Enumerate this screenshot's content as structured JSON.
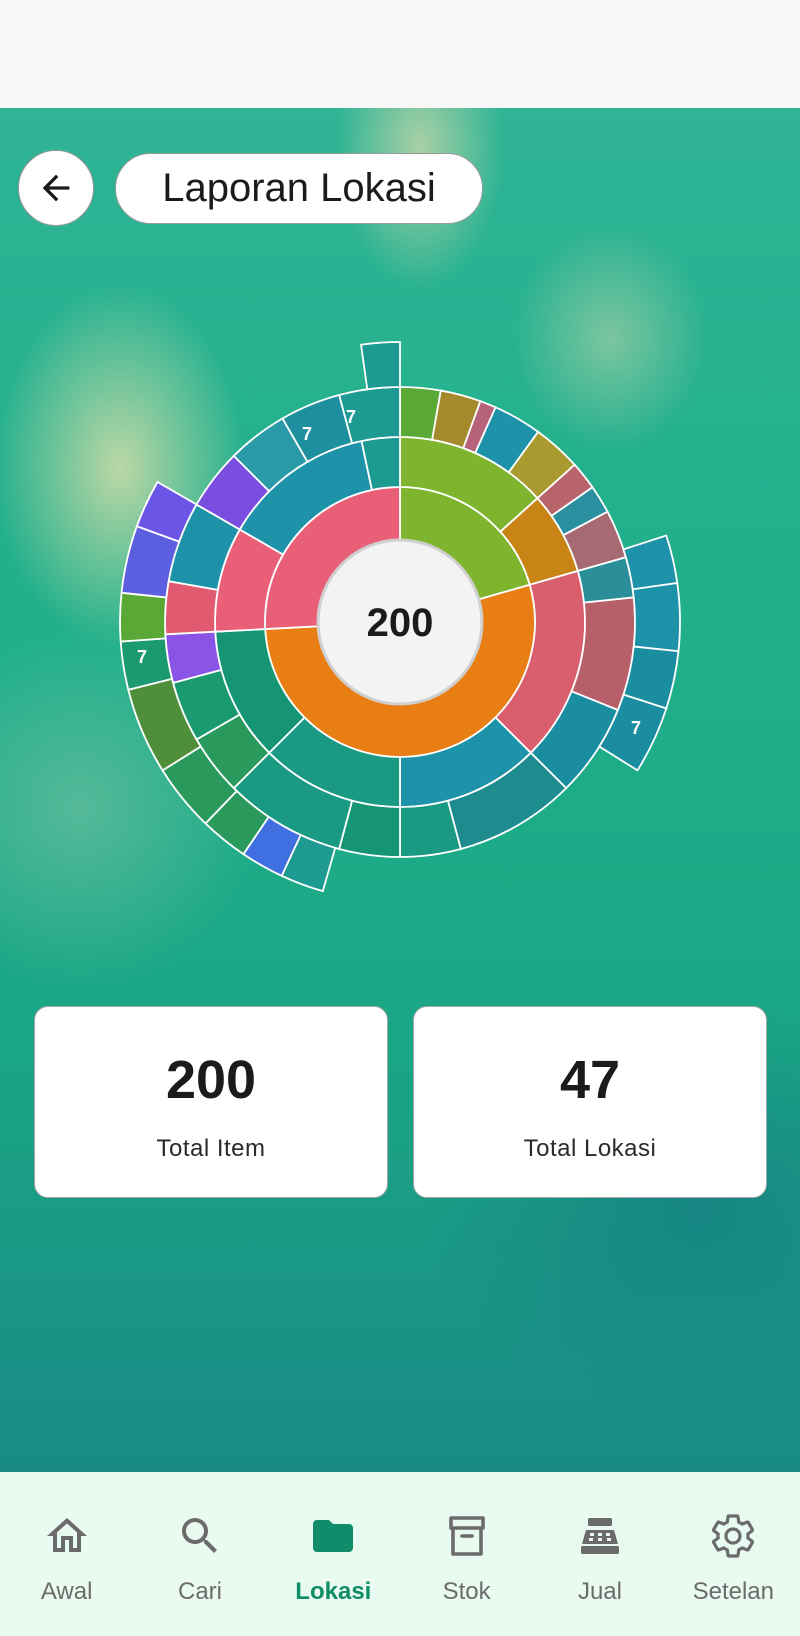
{
  "header": {
    "back_icon": "arrow-left-icon",
    "title": "Laporan Lokasi"
  },
  "sunburst": {
    "center_label": "200",
    "segment_labels": [
      "7",
      "7",
      "7",
      "7"
    ]
  },
  "stats": [
    {
      "value": "200",
      "label": "Total Item"
    },
    {
      "value": "47",
      "label": "Total Lokasi"
    }
  ],
  "nav": {
    "items": [
      {
        "label": "Awal",
        "icon": "home-icon"
      },
      {
        "label": "Cari",
        "icon": "search-icon"
      },
      {
        "label": "Lokasi",
        "icon": "folder-icon",
        "active": true
      },
      {
        "label": "Stok",
        "icon": "archive-icon"
      },
      {
        "label": "Jual",
        "icon": "cash-register-icon"
      },
      {
        "label": "Setelan",
        "icon": "gear-icon"
      }
    ]
  },
  "colors": {
    "accent": "#0f8d6a",
    "ring_orange": "#e97e14",
    "ring_green": "#7fb52e",
    "ring_pink": "#ea5f78",
    "ring_teal": "#1f9c90",
    "ring_blue": "#1e92a8",
    "ring_purple": "#8a55e6"
  }
}
